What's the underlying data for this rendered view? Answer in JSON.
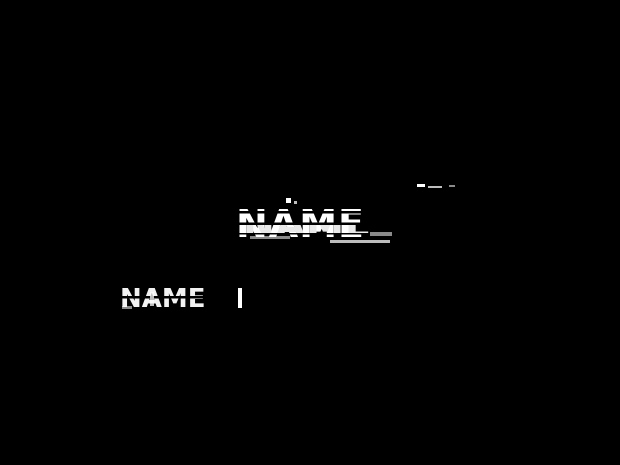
{
  "screen": {
    "background": "#000000",
    "title": "NAME",
    "subtitle": "NAME",
    "text_color": "#ffffff"
  }
}
